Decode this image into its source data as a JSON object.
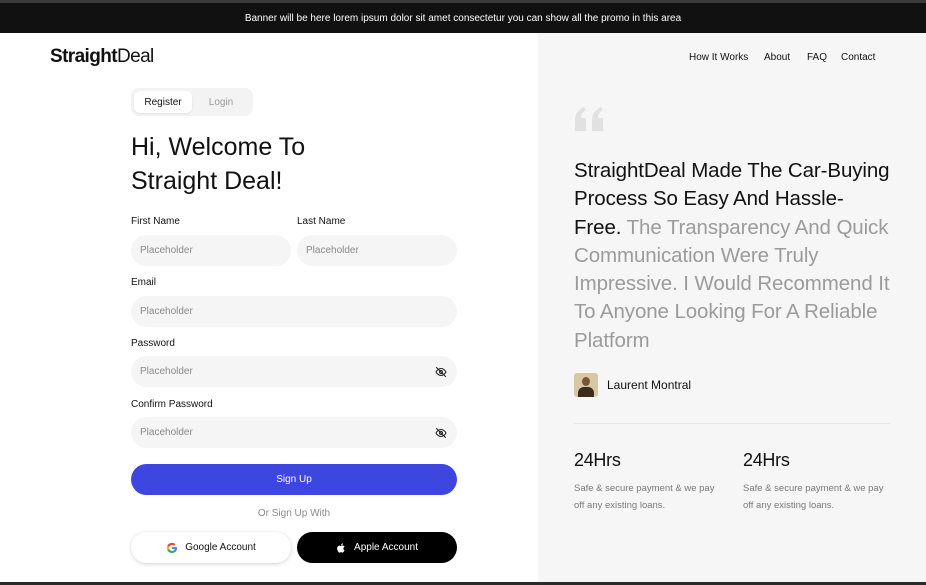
{
  "banner": {
    "text": "Banner will be here lorem ipsum dolor sit amet consectetur you can show all the promo in this area"
  },
  "logo": {
    "bold": "Straight",
    "light": "Deal"
  },
  "auth_tabs": {
    "register": "Register",
    "login": "Login",
    "active": "Register"
  },
  "heading": {
    "line1": "Hi, Welcome To",
    "line2": "Straight Deal!"
  },
  "form": {
    "first_name": {
      "label": "First Name",
      "placeholder": "Placeholder",
      "value": ""
    },
    "last_name": {
      "label": "Last Name",
      "placeholder": "Placeholder",
      "value": ""
    },
    "email": {
      "label": "Email",
      "placeholder": "Placeholder",
      "value": ""
    },
    "password": {
      "label": "Password",
      "placeholder": "Placeholder",
      "value": "",
      "icon": "eye-off-icon"
    },
    "confirm_password": {
      "label": "Confirm Password",
      "placeholder": "Placeholder",
      "value": "",
      "icon": "eye-off-icon"
    },
    "submit_label": "Sign Up",
    "or_text": "Or Sign Up With",
    "google_label": "Google Account",
    "apple_label": "Apple Account"
  },
  "nav": {
    "items": [
      "How It Works",
      "About",
      "FAQ",
      "Contact"
    ]
  },
  "testimonial": {
    "quote_dark": "StraightDeal Made The Car-Buying Process So Easy And Hassle-Free.",
    "quote_muted": "The Transparency And Quick Communication Were Truly Impressive. I Would Recommend It To Anyone Looking For A Reliable Platform",
    "author": "Laurent Montral"
  },
  "stats": [
    {
      "value": "24Hrs",
      "description": "Safe & secure payment & we pay off any existing loans."
    },
    {
      "value": "24Hrs",
      "description": "Safe & secure payment & we pay off any existing loans."
    }
  ],
  "colors": {
    "primary": "#3d47e0",
    "banner_bg": "#111111",
    "panel_bg": "#f6f6f6",
    "muted_text": "#9b9b9b"
  }
}
